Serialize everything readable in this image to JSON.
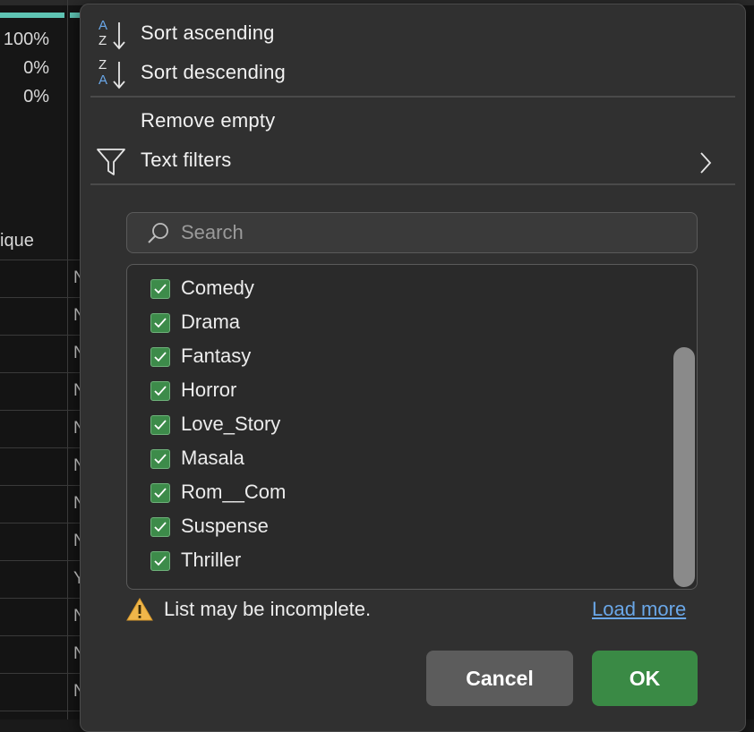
{
  "sheet": {
    "percentages": [
      "100%",
      "0%",
      "0%"
    ],
    "column_label": "ique",
    "row_letters": [
      "N",
      "N",
      "N",
      "N",
      "N",
      "N",
      "N",
      "N",
      "Y",
      "N",
      "N",
      "N"
    ]
  },
  "menu": {
    "sort_ascending": {
      "label": "Sort ascending",
      "icon": "sort-ascending-icon",
      "glyph_top": "A",
      "glyph_bottom": "Z"
    },
    "sort_descending": {
      "label": "Sort descending",
      "icon": "sort-descending-icon",
      "glyph_top": "Z",
      "glyph_bottom": "A"
    },
    "remove_empty": {
      "label": "Remove empty"
    },
    "text_filters": {
      "label": "Text filters",
      "icon": "funnel-icon"
    }
  },
  "search": {
    "placeholder": "Search",
    "value": ""
  },
  "list": {
    "items": [
      {
        "label": "Comedy",
        "checked": true
      },
      {
        "label": "Drama",
        "checked": true
      },
      {
        "label": "Fantasy",
        "checked": true
      },
      {
        "label": "Horror",
        "checked": true
      },
      {
        "label": "Love_Story",
        "checked": true
      },
      {
        "label": "Masala",
        "checked": true
      },
      {
        "label": "Rom__Com",
        "checked": true
      },
      {
        "label": "Suspense",
        "checked": true
      },
      {
        "label": "Thriller",
        "checked": true
      }
    ]
  },
  "warning": {
    "text": "List may be incomplete.",
    "link": "Load more"
  },
  "buttons": {
    "cancel": "Cancel",
    "ok": "OK"
  },
  "colors": {
    "panel": "#303030",
    "accent_blue": "#6aa7e8",
    "check_green": "#3d8b4a",
    "ok_green": "#3a8a45",
    "teal_strip": "#5fc4b4",
    "warning_yellow": "#f0b64a"
  }
}
